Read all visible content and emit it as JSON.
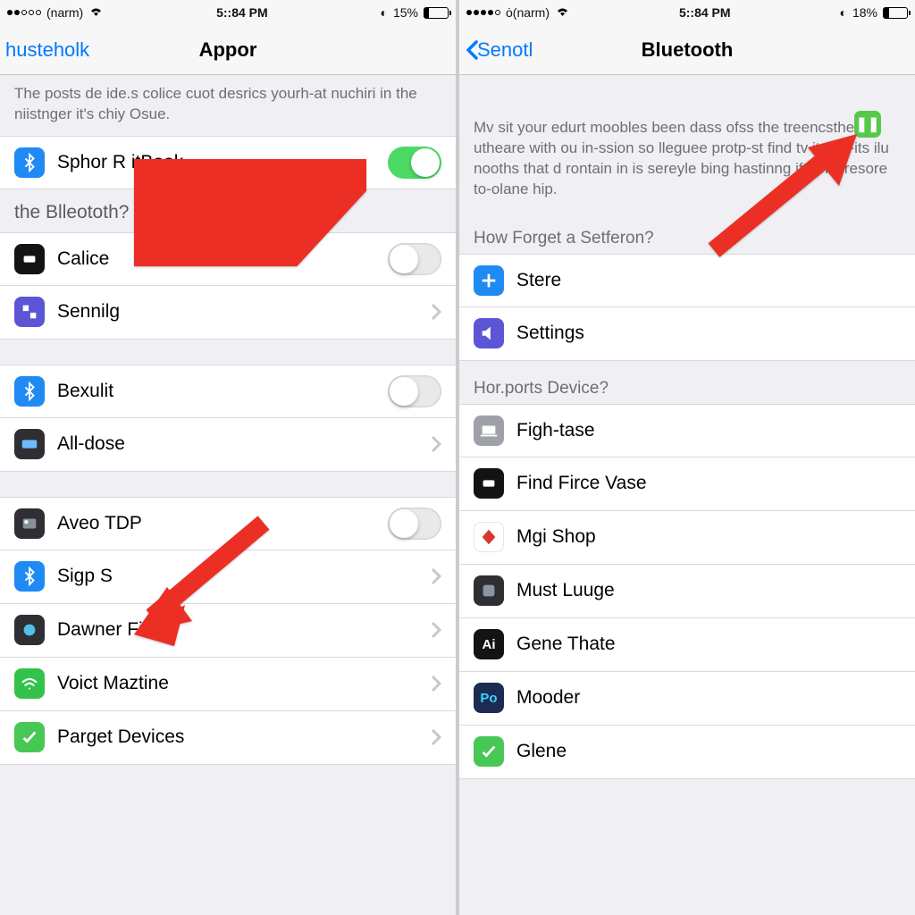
{
  "left": {
    "status": {
      "carrier": "(narm)",
      "time": "5::84 PM",
      "battery": "15%"
    },
    "nav": {
      "back": "husteholk",
      "title": "Appor"
    },
    "intro": "The posts de ide.s colice cuot desrics yourh-at nuchiri in the niistnger it's chiy Osue.",
    "main_row": {
      "label": "Sphor R itBook"
    },
    "section1_header": "the Blleototh?",
    "group1": [
      {
        "label": "Calice",
        "toggle": true
      },
      {
        "label": "Sennilg",
        "chevron": true
      }
    ],
    "group2": [
      {
        "label": "Bexulit",
        "toggle": true
      },
      {
        "label": "All-dose",
        "chevron": true
      }
    ],
    "group3": [
      {
        "label": "Aveo TDP",
        "toggle": true
      },
      {
        "label": "Sigp S",
        "chevron": true
      },
      {
        "label": "Dawner Fid",
        "chevron": true
      },
      {
        "label": "Voict Maztine",
        "chevron": true
      },
      {
        "label": "Parget Devices",
        "chevron": true
      }
    ]
  },
  "right": {
    "status": {
      "carrier": "ȯ(narm)",
      "time": "5::84 PM",
      "battery": "18%"
    },
    "nav": {
      "back": "Senotl",
      "title": "Bluetooth"
    },
    "intro": "Mv sit your edurt moobles been dass ofss the treencsthe utheare with ou in-ssion so lleguee protp-st find tv item t-its ilu nooths that d rontain in is sereyle bing hastinng ift dnts resore to-olane hip.",
    "section1_header": "How Forget a Setferon?",
    "group1": [
      {
        "label": "Stere"
      },
      {
        "label": "Settings"
      }
    ],
    "section2_header": "Hor.ports Device?",
    "group2": [
      {
        "label": "Figh-tase"
      },
      {
        "label": "Find Firce Vase"
      },
      {
        "label": "Mgi Shop"
      },
      {
        "label": "Must Luuge"
      },
      {
        "label": "Gene Thate"
      },
      {
        "label": "Mooder"
      },
      {
        "label": "Glene"
      }
    ]
  }
}
